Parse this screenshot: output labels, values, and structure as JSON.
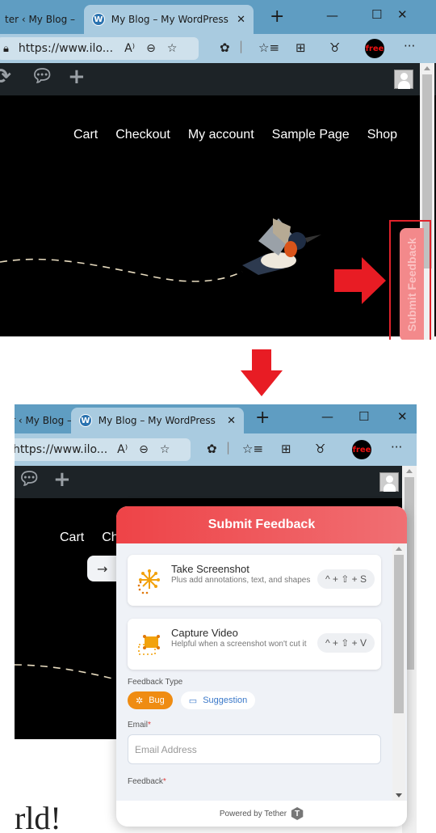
{
  "browser": {
    "tabs": [
      {
        "label": "ter ‹ My Blog –",
        "active": false
      },
      {
        "label": "My Blog – My WordPress Blo",
        "active": true
      }
    ],
    "tab_icon": "W",
    "new_tab": "+",
    "window_controls": {
      "minimize": "—",
      "maximize": "☐",
      "close": "✕"
    },
    "address": "https://www.ilo...",
    "address_short": "https://www.ilo...",
    "free_badge": "free",
    "more": "···"
  },
  "wp_admin_bar": {
    "icons": [
      "refresh-icon",
      "comment-icon",
      "plus-icon",
      "avatar"
    ]
  },
  "site_nav": {
    "items": [
      "Cart",
      "Checkout",
      "My account",
      "Sample Page",
      "Shop"
    ]
  },
  "feedback_tab": {
    "label": "Submit Feedback"
  },
  "annotations": {
    "highlight_color": "#e0222b",
    "arrow_color": "#e81c24"
  },
  "widget": {
    "header": "Submit Feedback",
    "options": [
      {
        "title": "Take Screenshot",
        "description": "Plus add annotations, text, and shapes",
        "shortcut": "^ + ⇧ + S",
        "icon": "screenshot-icon"
      },
      {
        "title": "Capture Video",
        "description": "Helpful when a screenshot won't cut it",
        "shortcut": "^ + ⇧ + V",
        "icon": "video-capture-icon"
      }
    ],
    "feedback_type": {
      "label": "Feedback Type",
      "options": [
        {
          "label": "Bug",
          "selected": true,
          "icon": "bug-icon"
        },
        {
          "label": "Suggestion",
          "selected": false,
          "icon": "suggestion-icon"
        }
      ]
    },
    "email": {
      "label": "Email",
      "required_mark": "*",
      "placeholder": "Email Address",
      "value": ""
    },
    "feedback": {
      "label": "Feedback",
      "required_mark": "*"
    },
    "footer": {
      "text": "Powered by Tether",
      "logo": "T"
    },
    "accent_colors": {
      "header_start": "#ee4347",
      "header_end": "#f06f73",
      "bug_chip": "#ef8c12",
      "suggestion_text": "#3a78c9"
    }
  },
  "page": {
    "back_arrow": "→",
    "heading_fragment": "rld!"
  }
}
